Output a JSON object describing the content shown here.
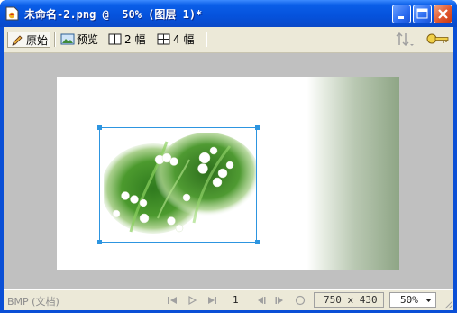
{
  "window": {
    "title": "未命名-2.png @  50% (图层 1)*",
    "buttons": {
      "minimize_icon": "minimize-icon",
      "maximize_icon": "maximize-icon",
      "close_icon": "close-icon"
    }
  },
  "toolbar": {
    "items": [
      {
        "label": "原始",
        "icon": "pencil-icon",
        "pressed": true
      },
      {
        "label": "预览",
        "icon": "picture-icon",
        "pressed": false
      },
      {
        "label": "2 幅",
        "icon": "two-pane-icon",
        "pressed": false
      },
      {
        "label": "4 幅",
        "icon": "four-pane-icon",
        "pressed": false
      }
    ],
    "right_icons": [
      "sort-arrows-icon",
      "key-icon"
    ]
  },
  "document": {
    "gradient_colors": [
      "#ffffff",
      "#8ea585"
    ],
    "photo_subject": "lily-of-the-valley flowers"
  },
  "statusbar": {
    "format": "BMP (文档)",
    "frame": "1",
    "size": "750 x 430",
    "zoom": "50%"
  }
}
